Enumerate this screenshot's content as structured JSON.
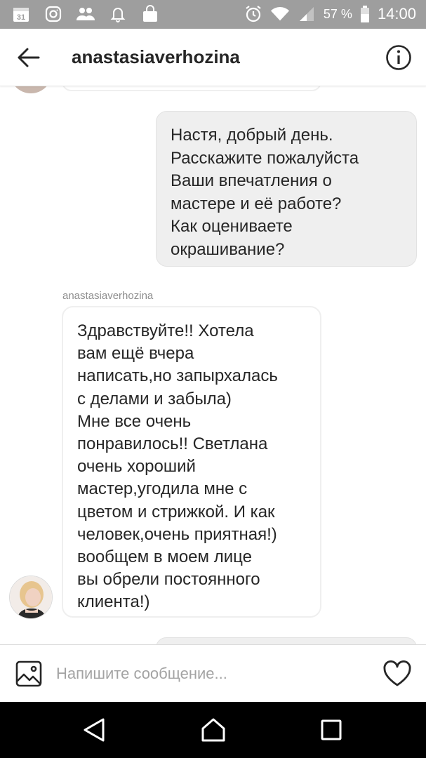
{
  "status_bar": {
    "battery_percent": "57 %",
    "time": "14:00",
    "calendar_day": "31",
    "icons": [
      "calendar-icon",
      "instagram-icon",
      "people-icon",
      "notification-bell-icon",
      "shopping-bag-icon",
      "alarm-icon",
      "wifi-icon",
      "signal-icon",
      "battery-icon"
    ]
  },
  "header": {
    "title": "anastasiaverhozina"
  },
  "messages": {
    "outgoing_1": "Настя, добрый день.\nРасскажите пожалуйста\nВаши впечатления о\nмастере и её работе?\nКак оцениваете\nокрашивание?",
    "incoming_sender": "anastasiaverhozina",
    "incoming_1": "Здравствуйте!! Хотела\nвам ещё вчера\nнаписать,но запырхалась\nс делами и забыла)\nМне все очень\nпонравилось!! Светлана\nочень хороший\nмастер,угодила мне с\nцветом и стрижкой. И как\nчеловек,очень приятная!)\nвообщем в моем лице\nвы обрели постоянного\nклиента!)"
  },
  "composer": {
    "placeholder": "Напишите сообщение..."
  },
  "colors": {
    "status_bar_bg": "#9e9e9e",
    "outgoing_bubble_bg": "#efefef",
    "incoming_bubble_border": "#efefef",
    "nav_bar_bg": "#000000"
  }
}
